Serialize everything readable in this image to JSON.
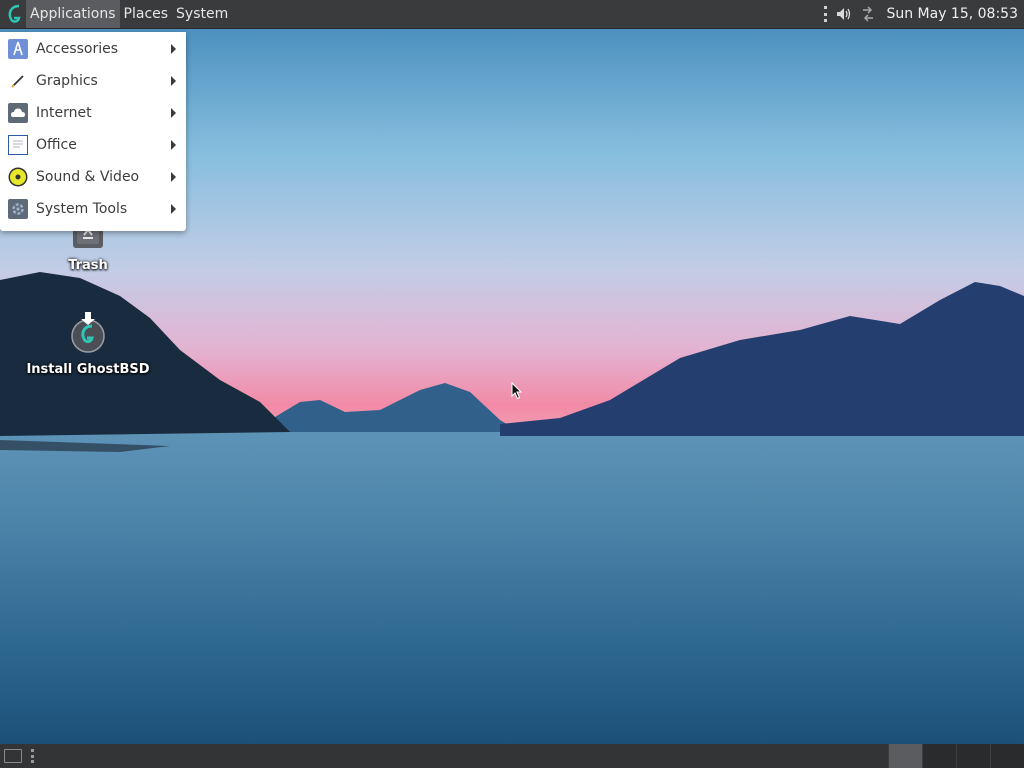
{
  "top_panel": {
    "menus": [
      "Applications",
      "Places",
      "System"
    ],
    "clock": "Sun May 15, 08:53",
    "tray_icons": [
      "volume-icon",
      "network-icon"
    ]
  },
  "applications_menu": {
    "items": [
      {
        "label": "Accessories",
        "icon": "accessories-icon"
      },
      {
        "label": "Graphics",
        "icon": "graphics-icon"
      },
      {
        "label": "Internet",
        "icon": "internet-icon"
      },
      {
        "label": "Office",
        "icon": "office-icon"
      },
      {
        "label": "Sound & Video",
        "icon": "sound-video-icon"
      },
      {
        "label": "System Tools",
        "icon": "system-tools-icon"
      }
    ]
  },
  "desktop": {
    "icons": [
      {
        "label": "Trash",
        "icon": "trash-icon"
      },
      {
        "label": "Install GhostBSD",
        "icon": "ghostbsd-installer-icon"
      }
    ]
  },
  "bottom_panel": {
    "workspaces": 4,
    "active_workspace": 1
  },
  "colors": {
    "panel": "#3a3b3d",
    "menu_active": "#5a5c60",
    "accent": "#2ec4b6"
  }
}
